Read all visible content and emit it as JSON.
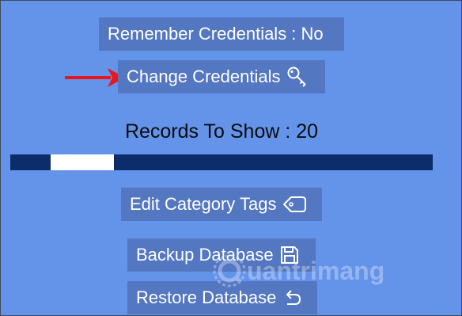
{
  "settings": {
    "remember_credentials_label": "Remember Credentials : No",
    "change_credentials_label": "Change Credentials",
    "records_to_show_label": "Records To Show : 20",
    "records_slider_fraction": 0.17,
    "edit_category_tags_label": "Edit Category Tags",
    "backup_database_label": "Backup Database",
    "restore_database_label": "Restore Database"
  },
  "icons": {
    "change_credentials": "key-icon",
    "edit_category_tags": "tag-icon",
    "backup_database": "floppy-disk-icon",
    "restore_database": "undo-icon",
    "annotation": "red-arrow-icon"
  },
  "watermark": {
    "text": "uantrimang"
  },
  "colors": {
    "background": "#6493ea",
    "button": "#5477c1",
    "slider_track": "#0c2d69",
    "slider_thumb": "#ffffff",
    "arrow": "#e8161f"
  }
}
